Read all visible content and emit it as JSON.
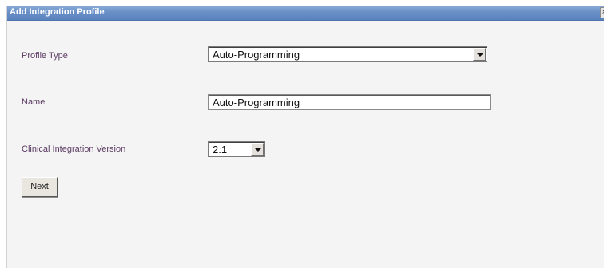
{
  "dialog": {
    "title": "Add Integration Profile",
    "close_symbol": "×"
  },
  "form": {
    "profile_type": {
      "label": "Profile Type",
      "value": "Auto-Programming"
    },
    "name": {
      "label": "Name",
      "value": "Auto-Programming"
    },
    "clinical_integration_version": {
      "label": "Clinical Integration Version",
      "value": "2.1"
    },
    "next_label": "Next"
  },
  "icons": {
    "close": "close-icon",
    "dropdown": "chevron-down-icon"
  },
  "colors": {
    "title_bar": "#6a90c6",
    "label_text": "#5b3a62",
    "dialog_background": "#f4f4f4"
  }
}
